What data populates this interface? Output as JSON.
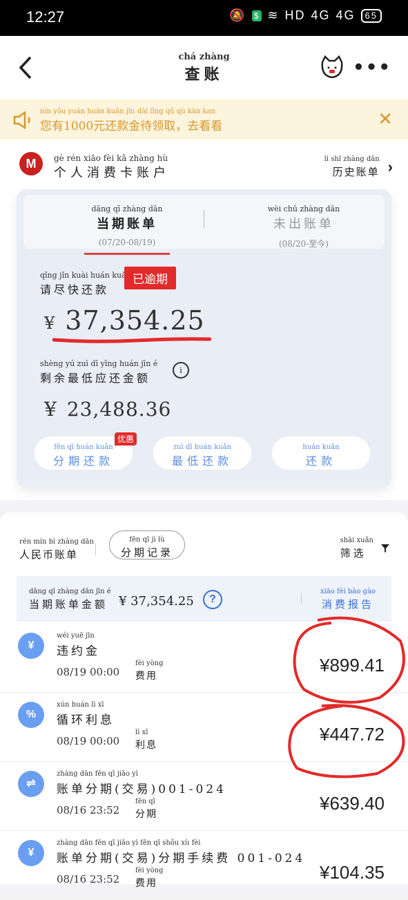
{
  "status": {
    "time": "12:27",
    "net": "HD",
    "sig1": "4G",
    "sig2": "4G",
    "battery": "65"
  },
  "nav": {
    "title_py": "chá zhàng",
    "title": "查账"
  },
  "notice": {
    "py": "nín yǒu yuán huán kuǎn jīn dài lǐng qǔ qù kàn kan",
    "text": "您有1000元还款金待领取，去看看"
  },
  "account": {
    "logo": "M",
    "title_py": "gè rén xiāo fèi kǎ zhàng hù",
    "title": "个人消费卡账户",
    "history_py": "lì shǐ zhàng dān",
    "history": "历史账单"
  },
  "card": {
    "tab_current_py": "dāng qī zhàng dān",
    "tab_current": "当期账单",
    "tab_current_range": "(07/20-08/19)",
    "tab_future_py": "wèi chū zhàng dān",
    "tab_future": "未出账单",
    "tab_future_range": "(08/20-至今)",
    "hurry_py": "qǐng jǐn kuài huán kuǎn",
    "hurry": "请尽快还款",
    "overdue": "已逾期",
    "currency": "¥",
    "amount": "37,354.25",
    "minpay_py": "shèng yú zuì dī yīng huán jīn é",
    "minpay": "剩余最低应还金额",
    "min_amount": "23,488.36",
    "btn_installment_py": "fēn qī huán kuǎn",
    "btn_installment": "分期还款",
    "promo": "优惠",
    "btn_minimum_py": "zuì dī huán kuǎn",
    "btn_minimum": "最低还款",
    "btn_repay_py": "huán kuǎn",
    "btn_repay": "还款"
  },
  "section": {
    "rmb_py": "rén mín bì zhàng dān",
    "rmb": "人民币账单",
    "record_py": "fēn qī jì lù",
    "record": "分期记录",
    "filter_py": "shāi xuǎn",
    "filter": "筛选",
    "summary_py": "dāng qī zhàng dān jīn é",
    "summary": "当期账单金额",
    "summary_amount": "¥ 37,354.25",
    "report_py": "xiāo fèi bào gào",
    "report": "消费报告"
  },
  "transactions": [
    {
      "icon": "¥",
      "title_py": "wéi yuē jīn",
      "title": "违约金",
      "date": "08/19 00:00",
      "type_py": "fèi yòng",
      "type": "费用",
      "amount": "¥899.41"
    },
    {
      "icon": "%",
      "title_py": "xún huán lì xī",
      "title": "循环利息",
      "date": "08/19 00:00",
      "type_py": "lì xī",
      "type": "利息",
      "amount": "¥447.72"
    },
    {
      "icon": "⇌",
      "title_py": "zhàng dān fēn qī jiāo yì",
      "title": "账单分期(交易)001-024",
      "date": "08/16 23:52",
      "type_py": "fēn qī",
      "type": "分期",
      "amount": "¥639.40"
    },
    {
      "icon": "¥",
      "title_py": "zhàng dān fēn qī jiāo yì fēn qī shǒu xù fèi",
      "title": "账单分期(交易)分期手续费 001-024",
      "date": "08/16 23:52",
      "type_py": "fèi yòng",
      "type": "费用",
      "amount": "¥104.35"
    }
  ]
}
